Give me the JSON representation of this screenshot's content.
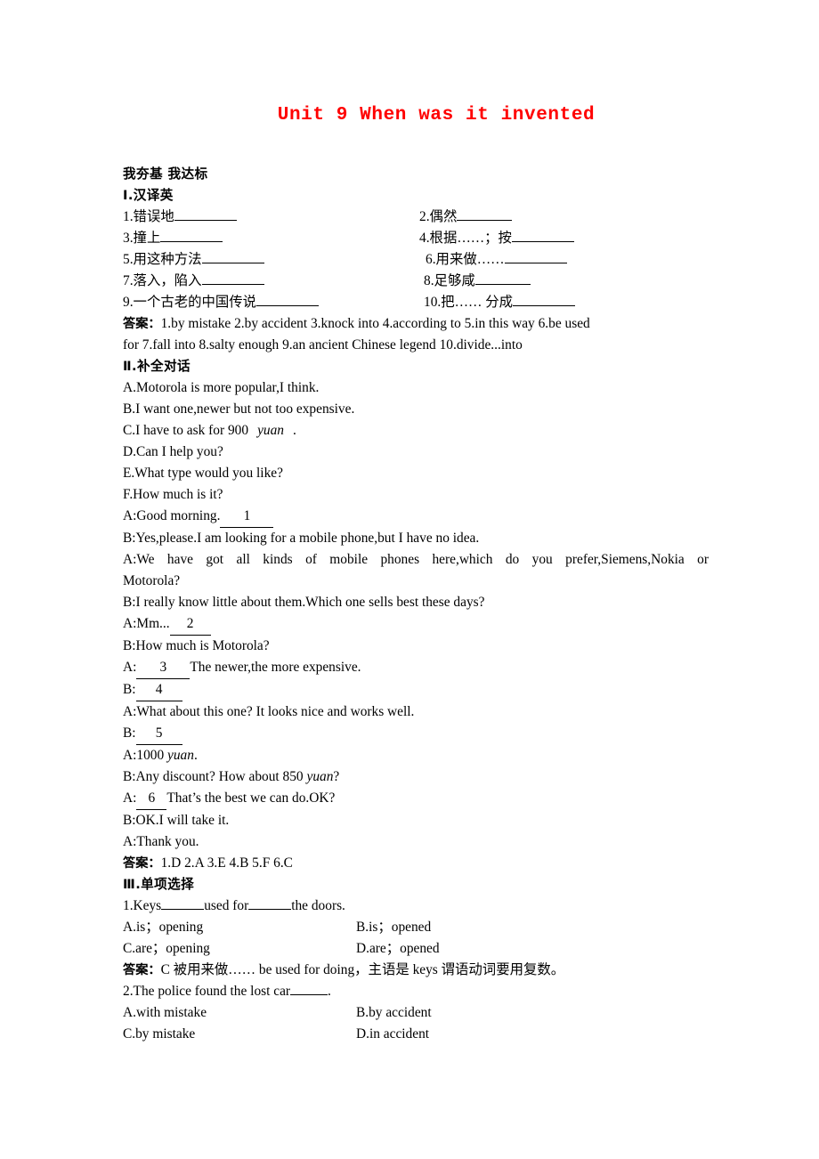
{
  "document": {
    "title": "Unit 9 When was it invented",
    "title_color": "#FF0000",
    "section_header": "我夯基 我达标"
  },
  "section1": {
    "heading": "Ⅰ.汉译英",
    "items": [
      {
        "num": "1.",
        "text": "错误地"
      },
      {
        "num": "2.",
        "text": "偶然"
      },
      {
        "num": "3.",
        "text": "撞上"
      },
      {
        "num": "4.",
        "text": "根据……；按"
      },
      {
        "num": "5.",
        "text": "用这种方法"
      },
      {
        "num": "6.",
        "text": "用来做……"
      },
      {
        "num": "7.",
        "text": "落入，陷入"
      },
      {
        "num": "8.",
        "text": "足够咸"
      },
      {
        "num": "9.",
        "text": "一个古老的中国传说"
      },
      {
        "num": "10.",
        "text": "把…… 分成"
      }
    ],
    "answer_label": "答案：",
    "answer_line1": "1.by mistake   2.by accident   3.knock into   4.according to   5.in this way   6.be used",
    "answer_line2": "for   7.fall into   8.salty enough   9.an ancient Chinese legend   10.divide...into"
  },
  "section2": {
    "heading": "Ⅱ.补全对话",
    "choices": [
      "A.Motorola is more popular,I think.",
      "B.I want one,newer but not too expensive.",
      "D.Can I help you?",
      "E.What type would you like?",
      "F.How much is it?"
    ],
    "choice_c_pre": "C.I have to ask for 900",
    "choice_c_yuan": "yuan",
    "choice_c_post": ".",
    "dialogue": {
      "l1_pre": "A:Good morning.",
      "l1_blank": "1",
      "l2": "B:Yes,please.I am looking for a mobile phone,but I have no idea.",
      "l3_justified": "A:We have got all kinds of mobile phones here,which do you prefer,Siemens,Nokia or",
      "l3_cont": "Motorola?",
      "l4": "B:I really know little about them.Which one sells best these days?",
      "l5_pre": "A:Mm...",
      "l5_blank": "2",
      "l6": "B:How much is Motorola?",
      "l7_pre": "A:",
      "l7_blank": "3",
      "l7_post": "The newer,the more expensive.",
      "l8_pre": "B:",
      "l8_blank": "4",
      "l9": "A:What about this one? It looks nice and works well.",
      "l10_pre": "B:",
      "l10_blank": "5",
      "l11_pre": "A:1000 ",
      "l11_yuan": "yuan",
      "l11_post": ".",
      "l12_pre": "B:Any discount? How about 850 ",
      "l12_yuan": "yuan",
      "l12_post": "?",
      "l13_pre": "A:",
      "l13_blank": "6",
      "l13_post": "That’s the best we can do.OK?",
      "l14": "B:OK.I will take it.",
      "l15": "A:Thank you."
    },
    "answer_label": "答案：",
    "answer_text": "1.D   2.A   3.E   4.B   5.F   6.C"
  },
  "section3": {
    "heading": "Ⅲ.单项选择",
    "questions": [
      {
        "stem_pre": "1.Keys",
        "stem_mid": "used for",
        "stem_post": "the doors.",
        "options": [
          {
            "label": "A.is；opening"
          },
          {
            "label": "B.is；opened"
          },
          {
            "label": "C.are；opening"
          },
          {
            "label": "D.are；opened"
          }
        ],
        "answer_label": "答案：",
        "answer_text": "C   被用来做…… be used for doing，主语是 keys 谓语动词要用复数。"
      },
      {
        "stem_pre": "2.The police found the lost car",
        "stem_post": ".",
        "options": [
          {
            "label": "A.with mistake"
          },
          {
            "label": "B.by accident"
          },
          {
            "label": "C.by mistake"
          },
          {
            "label": "D.in accident"
          }
        ]
      }
    ]
  }
}
